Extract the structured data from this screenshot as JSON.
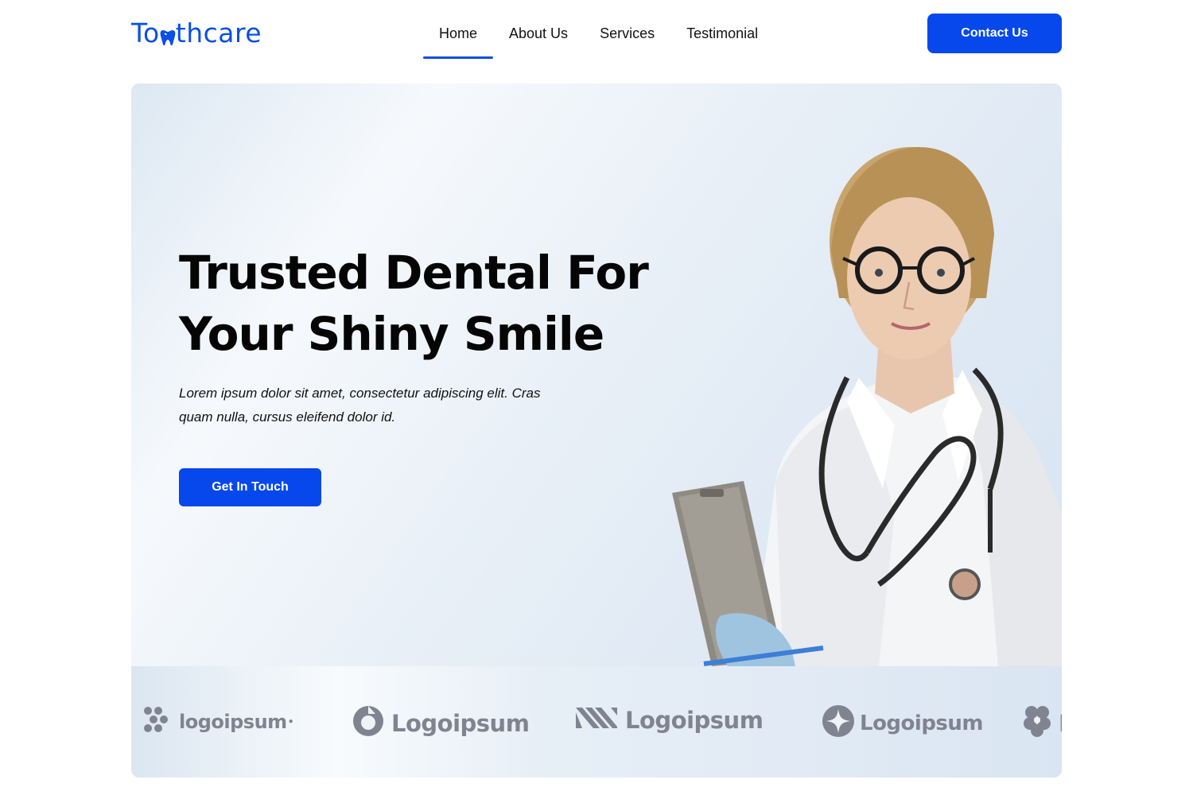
{
  "header": {
    "logo": {
      "prefix": "To",
      "suffix": "thcare",
      "color": "#0a4fe6",
      "icon": "tooth-icon"
    },
    "nav": [
      {
        "label": "Home",
        "active": true
      },
      {
        "label": "About Us",
        "active": false
      },
      {
        "label": "Services",
        "active": false
      },
      {
        "label": "Testimonial",
        "active": false
      }
    ],
    "contact_button": "Contact Us"
  },
  "hero": {
    "title_line1": "Trusted Dental For",
    "title_line2": "Your Shiny Smile",
    "subtitle": "Lorem ipsum dolor sit amet, consectetur adipiscing elit. Cras quam nulla, cursus eleifend dolor id.",
    "cta": "Get In Touch",
    "image": "doctor-photo"
  },
  "partners": [
    {
      "text": "logoipsum",
      "icon": "dots-icon"
    },
    {
      "text": "Logoipsum",
      "icon": "ring-icon"
    },
    {
      "text": "Logoipsum",
      "icon": "stripes-icon"
    },
    {
      "text": "Logoipsum",
      "icon": "star-circle-icon"
    },
    {
      "text": "L",
      "icon": "flower-icon"
    }
  ],
  "colors": {
    "accent": "#0648ec",
    "partner_gray": "#7f8490"
  }
}
